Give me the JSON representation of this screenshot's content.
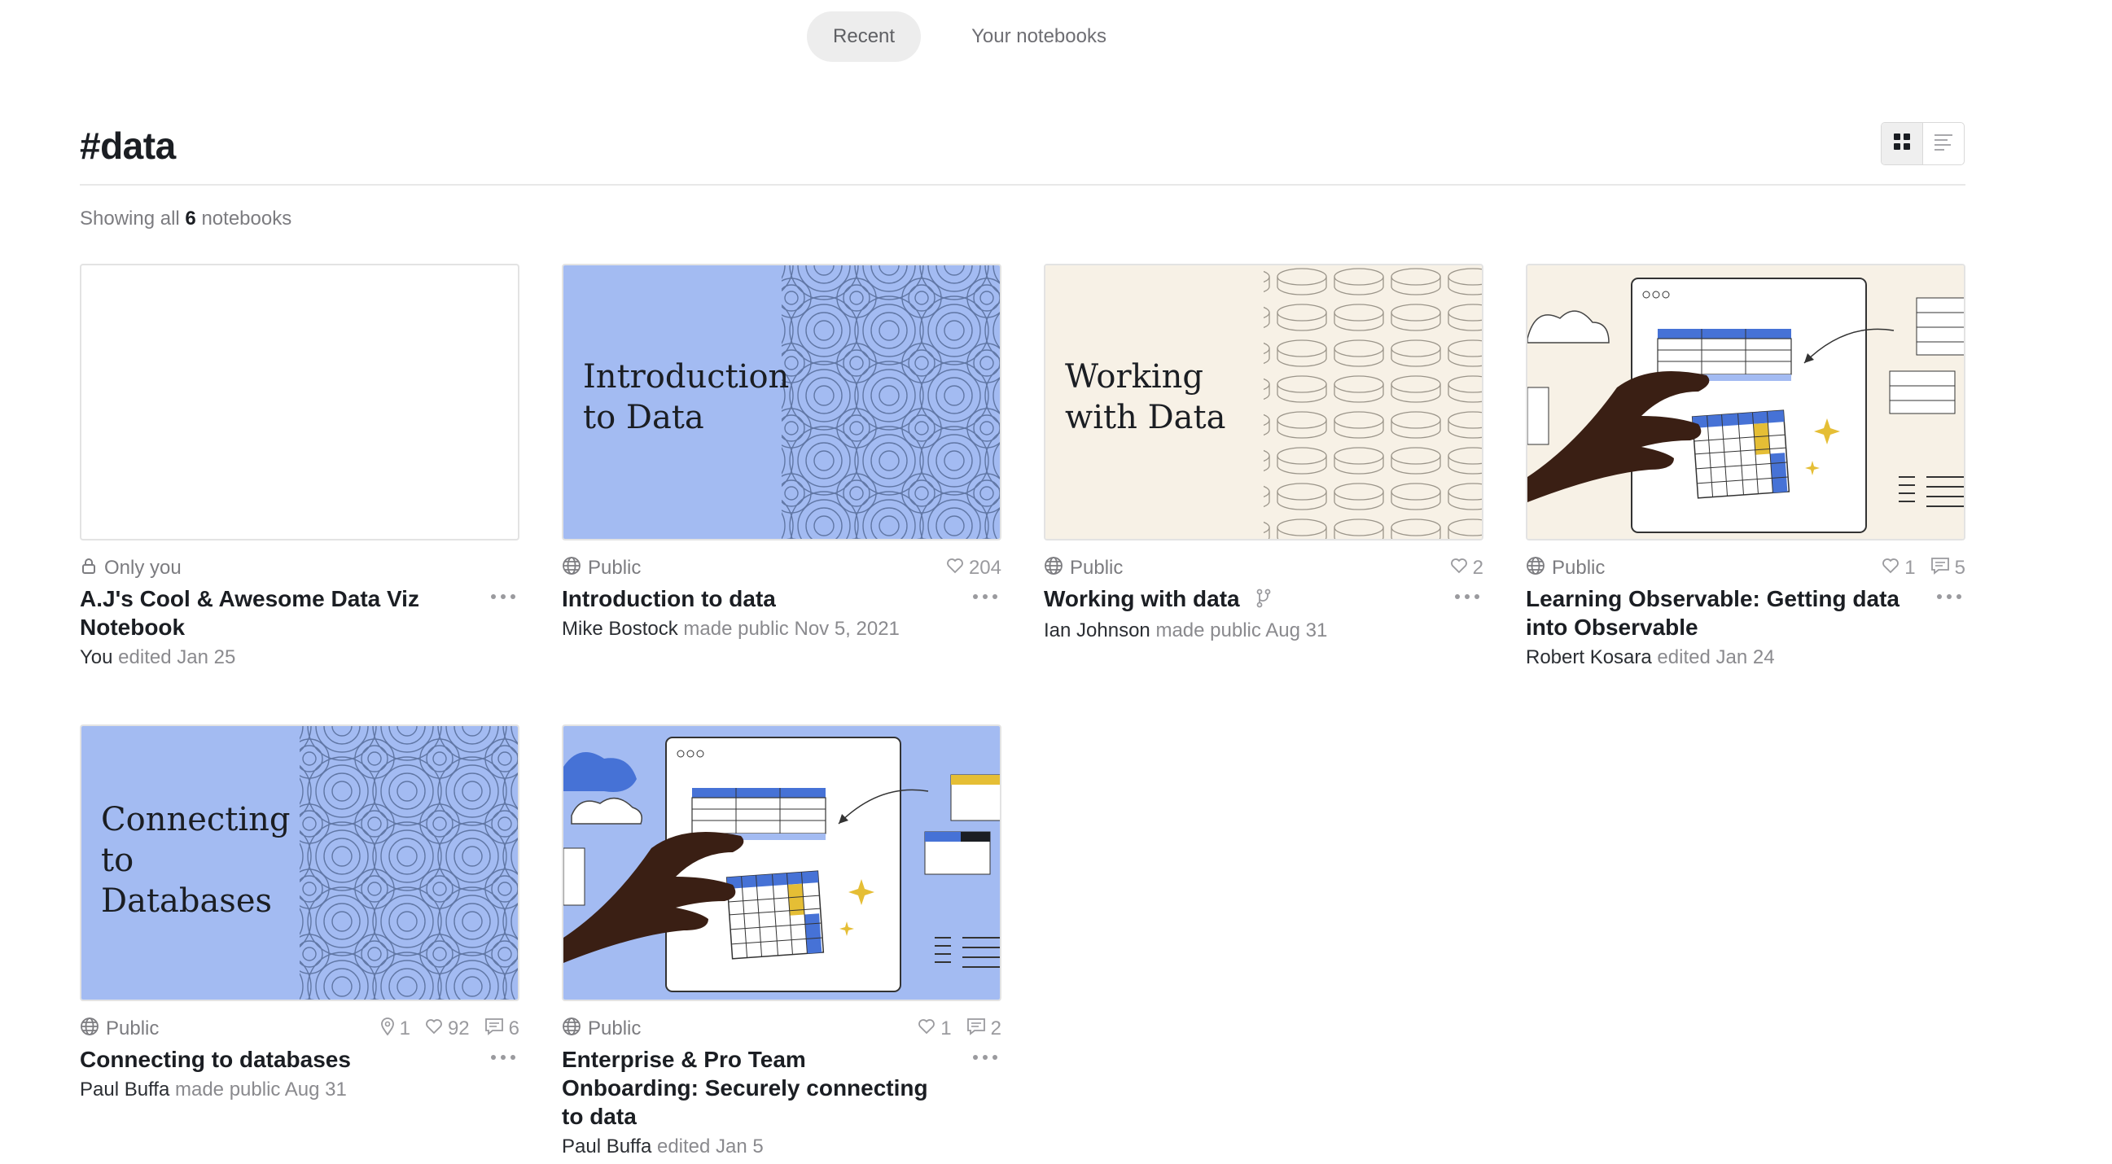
{
  "tabs": [
    {
      "label": "Recent",
      "active": true
    },
    {
      "label": "Your notebooks",
      "active": false
    }
  ],
  "header": {
    "title": "#data",
    "count_prefix": "Showing all",
    "count": "6",
    "count_suffix": "notebooks"
  },
  "view_toggle": {
    "grid_icon": "grid-icon",
    "list_icon": "list-icon",
    "active": "grid"
  },
  "colors": {
    "accent_blue": "#a3bbf2",
    "cream": "#f7f1e6",
    "hand": "#3a1f14",
    "yellow": "#e5be35",
    "blue_cell": "#4672d6"
  },
  "notebooks": [
    {
      "visibility": "Only you",
      "visibility_icon": "lock-icon",
      "title": "A.J's Cool & Awesome Data Viz Notebook",
      "author": "You",
      "action": "edited",
      "date": "Jan 25",
      "thumb_text": ""
    },
    {
      "visibility": "Public",
      "visibility_icon": "globe-icon",
      "likes": "204",
      "title": "Introduction to data",
      "author": "Mike Bostock",
      "action": "made public",
      "date": "Nov 5, 2021",
      "thumb_line1": "Introduction",
      "thumb_line2": "to Data"
    },
    {
      "visibility": "Public",
      "visibility_icon": "globe-icon",
      "likes": "2",
      "title": "Working with data",
      "author": "Ian Johnson",
      "action": "made public",
      "date": "Aug 31",
      "thumb_line1": "Working",
      "thumb_line2": "with Data"
    },
    {
      "visibility": "Public",
      "visibility_icon": "globe-icon",
      "likes": "1",
      "comments": "5",
      "title": "Learning Observable: Getting data into Observable",
      "author": "Robert Kosara",
      "action": "edited",
      "date": "Jan 24"
    },
    {
      "visibility": "Public",
      "visibility_icon": "globe-icon",
      "forks": "1",
      "likes": "92",
      "comments": "6",
      "title": "Connecting to databases",
      "author": "Paul Buffa",
      "action": "made public",
      "date": "Aug 31",
      "thumb_line1": "Connecting",
      "thumb_line2": "to",
      "thumb_line3": "Databases"
    },
    {
      "visibility": "Public",
      "visibility_icon": "globe-icon",
      "likes": "1",
      "comments": "2",
      "title": "Enterprise & Pro Team Onboarding: Securely connecting to data",
      "author": "Paul Buffa",
      "action": "edited",
      "date": "Jan 5"
    }
  ]
}
